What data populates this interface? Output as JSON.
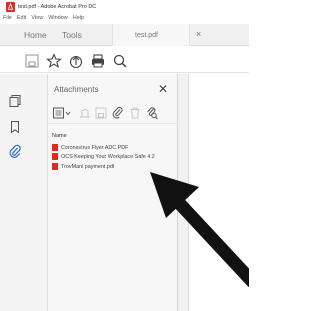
{
  "window": {
    "title": "test.pdf - Adobe Acrobat Pro DC"
  },
  "menu": [
    "File",
    "Edit",
    "View",
    "Window",
    "Help"
  ],
  "tabs": {
    "home": "Home",
    "tools": "Tools",
    "document": "test.pdf",
    "close": "×"
  },
  "toolbar": [
    "save-icon",
    "star-icon",
    "upload-icon",
    "print-icon",
    "search-icon"
  ],
  "rail": [
    "pages-icon",
    "bookmark-icon",
    "paperclip-icon"
  ],
  "attachments_panel": {
    "title": "Attachments",
    "close": "✕",
    "column_header": "Name",
    "files": [
      "Coronavirus Flyer ADC.PDF",
      "OCS Keeping Your Workplace Safe 4.2",
      "TrovMani payment.pdf"
    ]
  },
  "colors": {
    "pdf_red": "#e02b20",
    "panel_bg": "#f7f7f7",
    "arrow": "#111111"
  }
}
